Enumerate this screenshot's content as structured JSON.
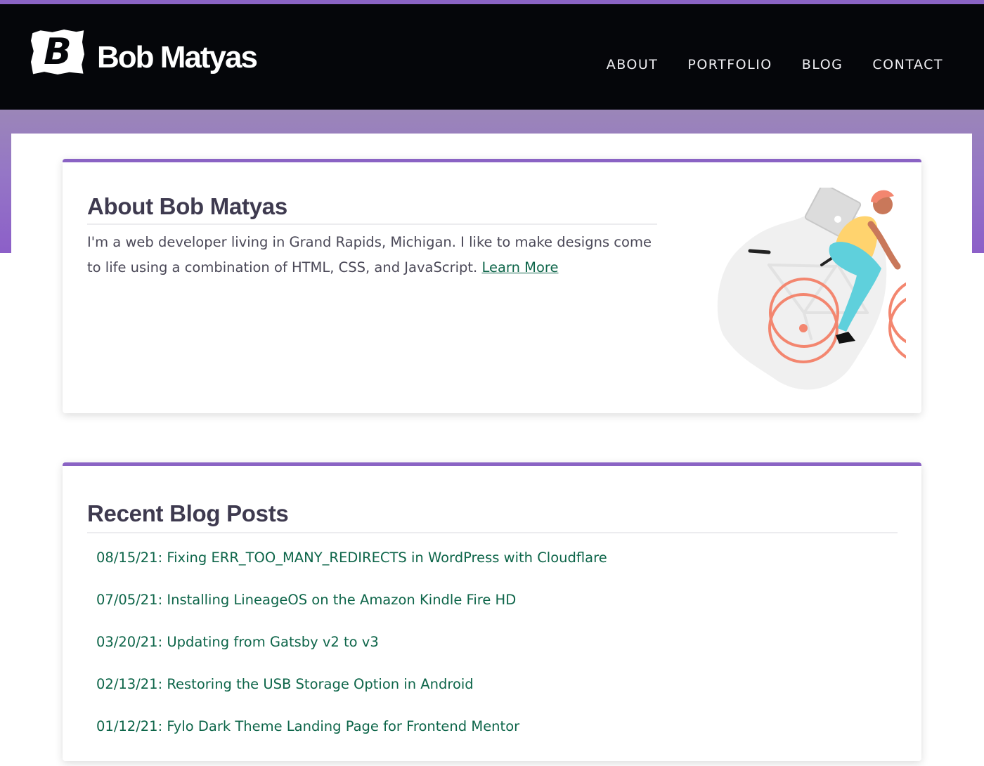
{
  "colors": {
    "accent": "#8a63c4",
    "header_bg": "#05060a",
    "link": "#0d6549",
    "heading": "#3e3a4f",
    "body_text": "#4a4857"
  },
  "header": {
    "logo_letter": "B",
    "site_title": "Bob Matyas",
    "nav": [
      {
        "label": "ABOUT"
      },
      {
        "label": "PORTFOLIO"
      },
      {
        "label": "BLOG"
      },
      {
        "label": "CONTACT"
      }
    ]
  },
  "about": {
    "heading": "About Bob Matyas",
    "body": "I'm a web developer living in Grand Rapids, Michigan. I like to make designs come to life using a combination of HTML, CSS, and JavaScript.",
    "link_label": "Learn More",
    "illustration": "person-riding-bicycle-illustration"
  },
  "blog": {
    "heading": "Recent Blog Posts",
    "posts": [
      {
        "label": "08/15/21: Fixing ERR_TOO_MANY_REDIRECTS in WordPress with Cloudflare"
      },
      {
        "label": "07/05/21: Installing LineageOS on the Amazon Kindle Fire HD"
      },
      {
        "label": "03/20/21: Updating from Gatsby v2 to v3"
      },
      {
        "label": "02/13/21: Restoring the USB Storage Option in Android"
      },
      {
        "label": "01/12/21: Fylo Dark Theme Landing Page for Frontend Mentor"
      }
    ]
  }
}
